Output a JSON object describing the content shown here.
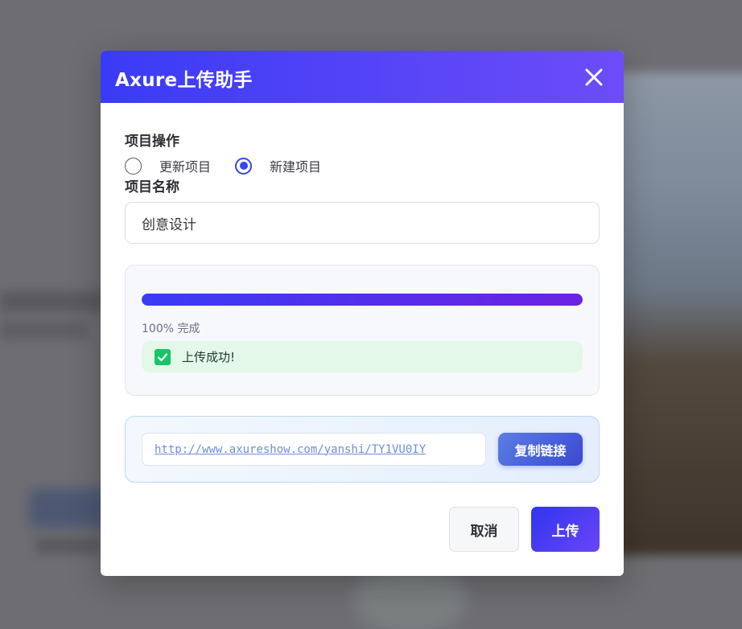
{
  "modal": {
    "title": "Axure上传助手",
    "section_operation_label": "项目操作",
    "radio_options": [
      {
        "label": "更新项目",
        "checked": false
      },
      {
        "label": "新建项目",
        "checked": true
      }
    ],
    "section_name_label": "项目名称",
    "project_name_value": "创意设计",
    "progress": {
      "percent": 100,
      "text": "100% 完成",
      "success_message": "上传成功!"
    },
    "link": {
      "url": "http://www.axureshow.com/yanshi/TY1VU0IY",
      "copy_label": "复制链接"
    },
    "buttons": {
      "cancel_label": "取消",
      "upload_label": "上传"
    }
  },
  "colors": {
    "header_gradient_start": "#3a3bf6",
    "header_gradient_end": "#6d4cf8",
    "radio_accent": "#3346f0",
    "success_bg": "#e3f8e8",
    "success_check": "#17c466",
    "link_color": "#6e8ed8"
  },
  "icons": {
    "close": "close-icon",
    "check": "check-icon"
  }
}
